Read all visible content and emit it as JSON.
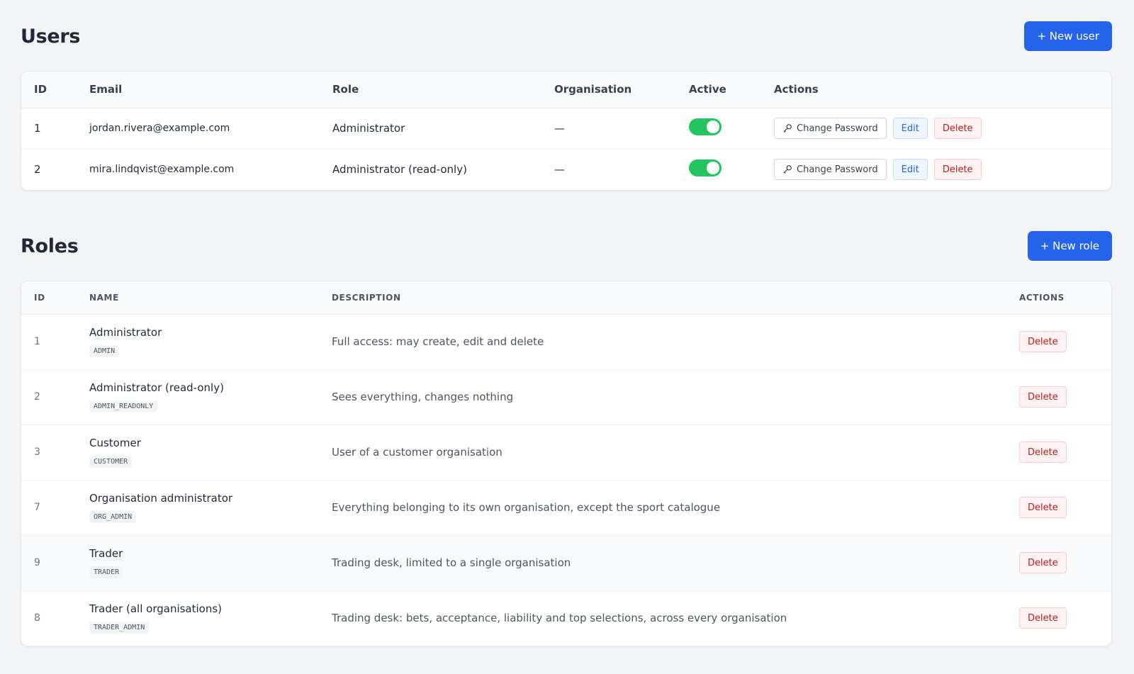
{
  "users_section": {
    "title": "Users",
    "new_button": "+ New user",
    "columns": [
      "ID",
      "Email",
      "Role",
      "Organisation",
      "Active",
      "Actions"
    ],
    "rows": [
      {
        "id": "1",
        "email": "jordan.rivera@example.com",
        "role": "Administrator",
        "organisation": "—",
        "active": true
      },
      {
        "id": "2",
        "email": "mira.lindqvist@example.com",
        "role": "Administrator (read-only)",
        "organisation": "—",
        "active": true
      }
    ],
    "actions": {
      "change_password": "Change Password",
      "edit": "Edit",
      "delete": "Delete"
    }
  },
  "roles_section": {
    "title": "Roles",
    "new_button": "+ New role",
    "columns": [
      "ID",
      "NAME",
      "DESCRIPTION",
      "ACTIONS"
    ],
    "rows": [
      {
        "id": "1",
        "name": "Administrator",
        "code": "ADMIN",
        "description": "Full access: may create, edit and delete"
      },
      {
        "id": "2",
        "name": "Administrator (read-only)",
        "code": "ADMIN_READONLY",
        "description": "Sees everything, changes nothing"
      },
      {
        "id": "3",
        "name": "Customer",
        "code": "CUSTOMER",
        "description": "User of a customer organisation"
      },
      {
        "id": "7",
        "name": "Organisation administrator",
        "code": "ORG_ADMIN",
        "description": "Everything belonging to its own organisation, except the sport catalogue"
      },
      {
        "id": "9",
        "name": "Trader",
        "code": "TRADER",
        "description": "Trading desk, limited to a single organisation"
      },
      {
        "id": "8",
        "name": "Trader (all organisations)",
        "code": "TRADER_ADMIN",
        "description": "Trading desk: bets, acceptance, liability and top selections, across every organisation"
      }
    ],
    "delete_label": "Delete"
  },
  "colors": {
    "primary": "#2563eb",
    "toggle_on": "#22c55e",
    "danger": "#b91c1c"
  }
}
